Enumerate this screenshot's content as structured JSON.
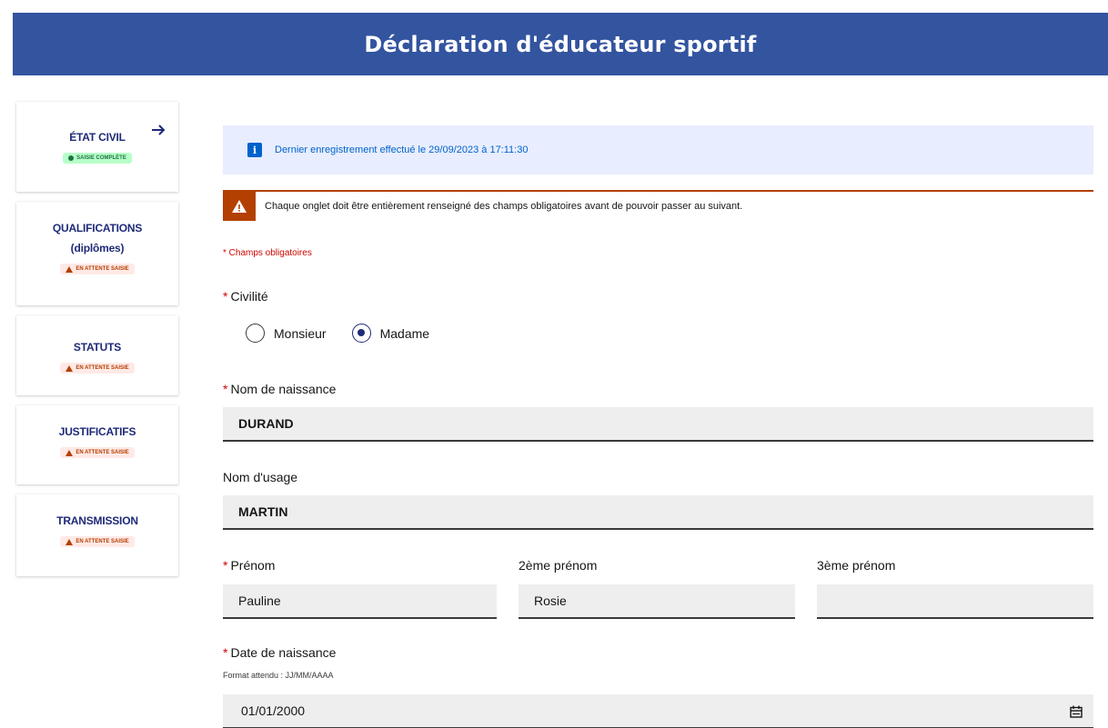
{
  "header": {
    "title": "Déclaration d'éducateur sportif"
  },
  "sidebar": {
    "steps": [
      {
        "label": "ÉTAT CIVIL",
        "badge": "SAISIE COMPLÈTE",
        "status": "complete"
      },
      {
        "label": "QUALIFICATIONS",
        "sublabel": "(diplômes)",
        "badge": "EN ATTENTE SAISIE",
        "status": "pending"
      },
      {
        "label": "STATUTS",
        "badge": "EN ATTENTE SAISIE",
        "status": "pending"
      },
      {
        "label": "JUSTIFICATIFS",
        "badge": "EN ATTENTE SAISIE",
        "status": "pending"
      },
      {
        "label": "TRANSMISSION",
        "badge": "EN ATTENTE SAISIE",
        "status": "pending"
      }
    ]
  },
  "notice": {
    "info": "Dernier enregistrement effectué le 29/09/2023 à 17:11:30",
    "warning": "Chaque onglet doit être entièrement renseigné des champs obligatoires avant de pouvoir passer au suivant."
  },
  "form": {
    "required_note": "* Champs obligatoires",
    "required_mark": "*",
    "civility": {
      "label": "Civilité",
      "options": [
        "Monsieur",
        "Madame"
      ],
      "selected": "Madame"
    },
    "birth_name": {
      "label": "Nom de naissance",
      "value": "DURAND"
    },
    "usage_name": {
      "label": "Nom d'usage",
      "value": "MARTIN"
    },
    "first_name": {
      "label": "Prénom",
      "value": "Pauline"
    },
    "second_name": {
      "label": "2ème prénom",
      "value": "Rosie"
    },
    "third_name": {
      "label": "3ème prénom",
      "value": ""
    },
    "birth_date": {
      "label": "Date de naissance",
      "hint": "Format attendu : JJ/MM/AAAA",
      "value": "01/01/2000"
    }
  },
  "colors": {
    "header": "#33549f",
    "title_blue": "#1e2a78",
    "info_bg": "#e8edff",
    "info_text": "#0063cb",
    "warning": "#b34000",
    "required": "#ce0500",
    "input_bg": "#eeeeee",
    "complete_badge_bg": "#b8fec9",
    "pending_badge_bg": "#ffe9e6"
  },
  "icons": {
    "step_arrow": "arrow-right-icon",
    "info": "info-icon",
    "warning": "warning-icon",
    "calendar": "calendar-icon",
    "status_ok": "check-circle-icon",
    "status_pending": "warning-triangle-icon"
  }
}
